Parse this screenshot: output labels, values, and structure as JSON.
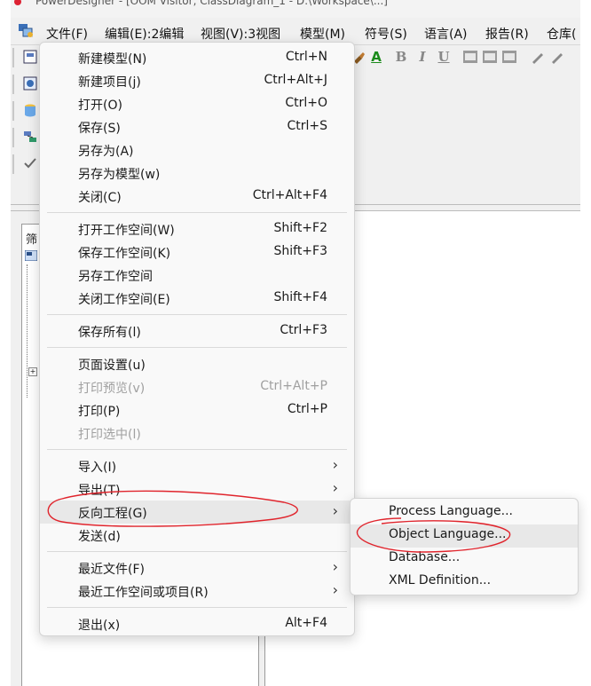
{
  "window": {
    "title": "PowerDesigner - [OOM Visitor, ClassDiagram_1 - D:\\Workspace\\...]"
  },
  "menubar": {
    "items": [
      {
        "label": "文件(F)"
      },
      {
        "label": "编辑(E):2编辑"
      },
      {
        "label": "视图(V):3视图"
      },
      {
        "label": "模型(M)"
      },
      {
        "label": "符号(S)"
      },
      {
        "label": "语言(A)"
      },
      {
        "label": "报告(R)"
      },
      {
        "label": "仓库("
      }
    ]
  },
  "browser_panel": {
    "label": "筛"
  },
  "file_menu": {
    "items": [
      {
        "label": "新建模型(N)",
        "shortcut": "Ctrl+N"
      },
      {
        "label": "新建项目(j)",
        "shortcut": "Ctrl+Alt+J"
      },
      {
        "label": "打开(O)",
        "shortcut": "Ctrl+O"
      },
      {
        "label": "保存(S)",
        "shortcut": "Ctrl+S"
      },
      {
        "label": "另存为(A)",
        "shortcut": ""
      },
      {
        "label": "另存为模型(w)",
        "shortcut": ""
      },
      {
        "label": "关闭(C)",
        "shortcut": "Ctrl+Alt+F4"
      },
      {
        "label": "打开工作空间(W)",
        "shortcut": "Shift+F2"
      },
      {
        "label": "保存工作空间(K)",
        "shortcut": "Shift+F3"
      },
      {
        "label": "另存工作空间",
        "shortcut": ""
      },
      {
        "label": "关闭工作空间(E)",
        "shortcut": "Shift+F4"
      },
      {
        "label": "保存所有(l)",
        "shortcut": "Ctrl+F3"
      },
      {
        "label": "页面设置(u)",
        "shortcut": ""
      },
      {
        "label": "打印预览(v)",
        "shortcut": "Ctrl+Alt+P",
        "disabled": true
      },
      {
        "label": "打印(P)",
        "shortcut": "Ctrl+P"
      },
      {
        "label": "打印选中(l)",
        "shortcut": "",
        "disabled": true
      },
      {
        "label": "导入(I)",
        "submenu": true
      },
      {
        "label": "导出(T)",
        "submenu": true
      },
      {
        "label": "反向工程(G)",
        "submenu": true,
        "highlighted": true
      },
      {
        "label": "发送(d)",
        "shortcut": ""
      },
      {
        "label": "最近文件(F)",
        "submenu": true
      },
      {
        "label": "最近工作空间或项目(R)",
        "submenu": true
      },
      {
        "label": "退出(x)",
        "shortcut": "Alt+F4"
      }
    ]
  },
  "reverse_engineering_submenu": {
    "items": [
      {
        "label": "Process Language..."
      },
      {
        "label": "Object Language...",
        "highlighted": true
      },
      {
        "label": "Database..."
      },
      {
        "label": "XML Definition..."
      }
    ]
  },
  "toolbar": {
    "format_buttons": [
      "B",
      "I",
      "U"
    ],
    "font_color_letter": "A"
  },
  "colors": {
    "annotation": "#e0242c",
    "menu_background": "#f9f9f9",
    "hover": "#e8e8e8",
    "disabled_text": "#a0a0a0"
  }
}
